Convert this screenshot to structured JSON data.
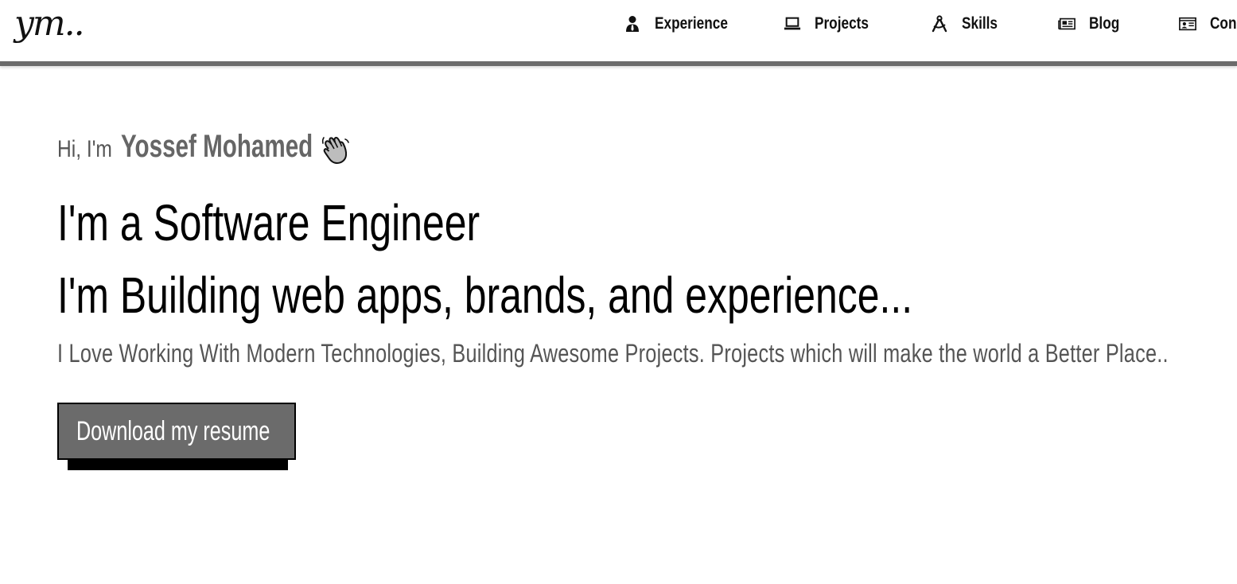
{
  "header": {
    "logo_text": "ym..",
    "nav": [
      {
        "label": "Experience",
        "icon": "user-tie-icon"
      },
      {
        "label": "Projects",
        "icon": "laptop-icon"
      },
      {
        "label": "Skills",
        "icon": "drafting-compass-icon"
      },
      {
        "label": "Blog",
        "icon": "newspaper-icon"
      },
      {
        "label": "Con",
        "icon": "contact-card-icon"
      }
    ],
    "accent_bar_color": "#6b6b6b"
  },
  "hero": {
    "greeting_prefix": "Hi, I'm",
    "name": "Yossef Mohamed",
    "wave_icon": "waving-hand-icon",
    "headline_1": "I'm a Software Engineer",
    "headline_2": "I'm Building web apps, brands, and experience...",
    "tagline": "I Love Working With Modern Technologies, Building Awesome Projects. Projects which will make the world a Better Place..",
    "resume_button_label": "Download my resume",
    "button_color": "#6b6b6b",
    "button_shadow_color": "#000000"
  }
}
